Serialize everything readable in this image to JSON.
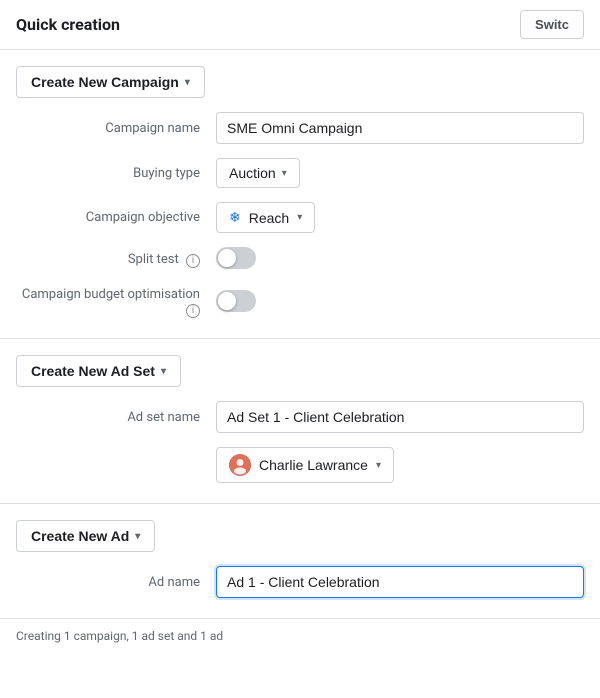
{
  "header": {
    "title": "Quick creation",
    "switch_label": "Switc"
  },
  "campaign_section": {
    "create_button": "Create New Campaign",
    "fields": {
      "campaign_name_label": "Campaign name",
      "campaign_name_value": "SME Omni Campaign",
      "buying_type_label": "Buying type",
      "buying_type_value": "Auction",
      "campaign_objective_label": "Campaign objective",
      "campaign_objective_icon": "❄",
      "campaign_objective_value": "Reach",
      "split_test_label": "Split test",
      "split_test_on": false,
      "campaign_budget_label": "Campaign budget optimisation",
      "campaign_budget_on": false
    }
  },
  "adset_section": {
    "create_button": "Create New Ad Set",
    "fields": {
      "ad_set_name_label": "Ad set name",
      "ad_set_name_value": "Ad Set 1 - Client Celebration",
      "person_name": "Charlie Lawrance"
    }
  },
  "ad_section": {
    "create_button": "Create New Ad",
    "fields": {
      "ad_name_label": "Ad name",
      "ad_name_value": "Ad 1 - Client Celebration"
    }
  },
  "footer": {
    "status_text": "Creating 1 campaign, 1 ad set and 1 ad"
  },
  "icons": {
    "dropdown_arrow": "▾",
    "info": "i",
    "snowflake": "❄"
  }
}
